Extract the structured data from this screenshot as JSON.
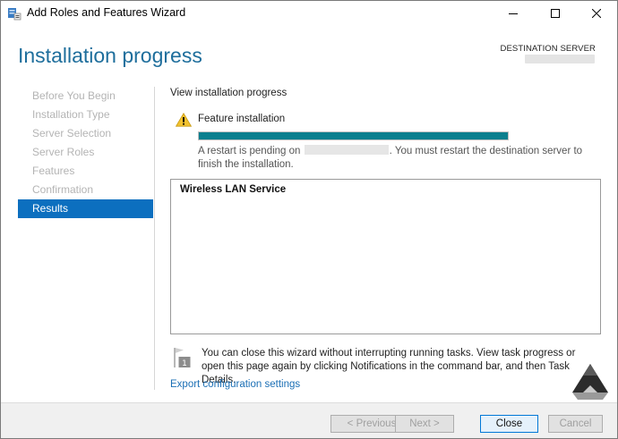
{
  "window": {
    "title": "Add Roles and Features Wizard",
    "controls": [
      "minimize",
      "maximize",
      "close"
    ]
  },
  "header": {
    "page_title": "Installation progress",
    "destination_label": "DESTINATION SERVER"
  },
  "nav": {
    "items": [
      {
        "label": "Before You Begin",
        "state": "disabled"
      },
      {
        "label": "Installation Type",
        "state": "disabled"
      },
      {
        "label": "Server Selection",
        "state": "disabled"
      },
      {
        "label": "Server Roles",
        "state": "disabled"
      },
      {
        "label": "Features",
        "state": "disabled"
      },
      {
        "label": "Confirmation",
        "state": "disabled"
      },
      {
        "label": "Results",
        "state": "active"
      }
    ]
  },
  "content": {
    "section_title": "View installation progress",
    "feature_label": "Feature installation",
    "progress_percent": 100,
    "restart_prefix": "A restart is pending on",
    "restart_suffix": ". You must restart the destination server to finish the installation.",
    "results_items": [
      "Wireless LAN Service"
    ],
    "info_text": "You can close this wizard without interrupting running tasks. View task progress or open this page again by clicking Notifications in the command bar, and then Task Details.",
    "export_link": "Export configuration settings"
  },
  "footer": {
    "previous_label": "< Previous",
    "next_label": "Next >",
    "close_label": "Close",
    "cancel_label": "Cancel"
  },
  "colors": {
    "title_blue": "#1e6e9c",
    "nav_active": "#0c6fbf",
    "progress_fill": "#0b7f8e",
    "link": "#1b6fb5",
    "warning": "#f2c230"
  }
}
